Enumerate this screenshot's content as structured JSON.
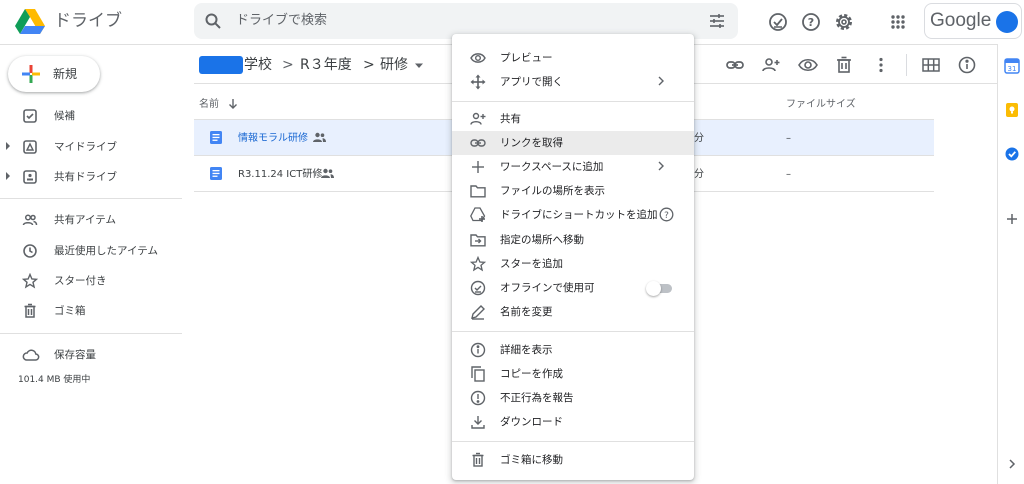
{
  "header": {
    "app_name": "ドライブ",
    "search_placeholder": "ドライブで検索",
    "google_label": "Google"
  },
  "sidebar": {
    "new_label": "新規",
    "items": [
      {
        "label": "候補",
        "icon": "suggested-icon"
      },
      {
        "label": "マイドライブ",
        "icon": "my-drive-icon"
      },
      {
        "label": "共有ドライブ",
        "icon": "shared-drives-icon"
      },
      {
        "label": "共有アイテム",
        "icon": "shared-people-icon"
      },
      {
        "label": "最近使用したアイテム",
        "icon": "clock-icon"
      },
      {
        "label": "スター付き",
        "icon": "star-icon"
      },
      {
        "label": "ゴミ箱",
        "icon": "trash-icon"
      },
      {
        "label": "保存容量",
        "icon": "cloud-icon"
      }
    ],
    "storage_used": "101.4 MB 使用中"
  },
  "breadcrumb": {
    "part1": "学校",
    "sep": ">",
    "part2": "R３年度",
    "part3": "研修"
  },
  "list": {
    "col_name": "名前",
    "col_size": "ファイルサイズ",
    "rows": [
      {
        "name": "情報モラル研修",
        "cell": "分",
        "size": "–"
      },
      {
        "name": "R3.11.24 ICT研修",
        "cell": "分",
        "size": "–"
      }
    ]
  },
  "menu": {
    "items": [
      {
        "label": "プレビュー",
        "icon": "eye-icon"
      },
      {
        "label": "アプリで開く",
        "icon": "open-with-icon"
      },
      {
        "label": "共有",
        "icon": "person-add-icon"
      },
      {
        "label": "リンクを取得",
        "icon": "link-icon"
      },
      {
        "label": "ワークスペースに追加",
        "icon": "plus-icon"
      },
      {
        "label": "ファイルの場所を表示",
        "icon": "folder-icon"
      },
      {
        "label": "ドライブにショートカットを追加",
        "icon": "add-shortcut-icon"
      },
      {
        "label": "指定の場所へ移動",
        "icon": "move-icon"
      },
      {
        "label": "スターを追加",
        "icon": "star-icon"
      },
      {
        "label": "オフラインで使用可",
        "icon": "offline-icon"
      },
      {
        "label": "名前を変更",
        "icon": "pencil-icon"
      },
      {
        "label": "詳細を表示",
        "icon": "info-icon"
      },
      {
        "label": "コピーを作成",
        "icon": "copy-icon"
      },
      {
        "label": "不正行為を報告",
        "icon": "report-icon"
      },
      {
        "label": "ダウンロード",
        "icon": "download-icon"
      },
      {
        "label": "ゴミ箱に移動",
        "icon": "trash-icon"
      }
    ],
    "offline_toggle_on": false
  },
  "colors": {
    "accent": "#1a73e8",
    "selected_row": "#e8f0fe",
    "menu_highlight": "#ebebeb"
  }
}
